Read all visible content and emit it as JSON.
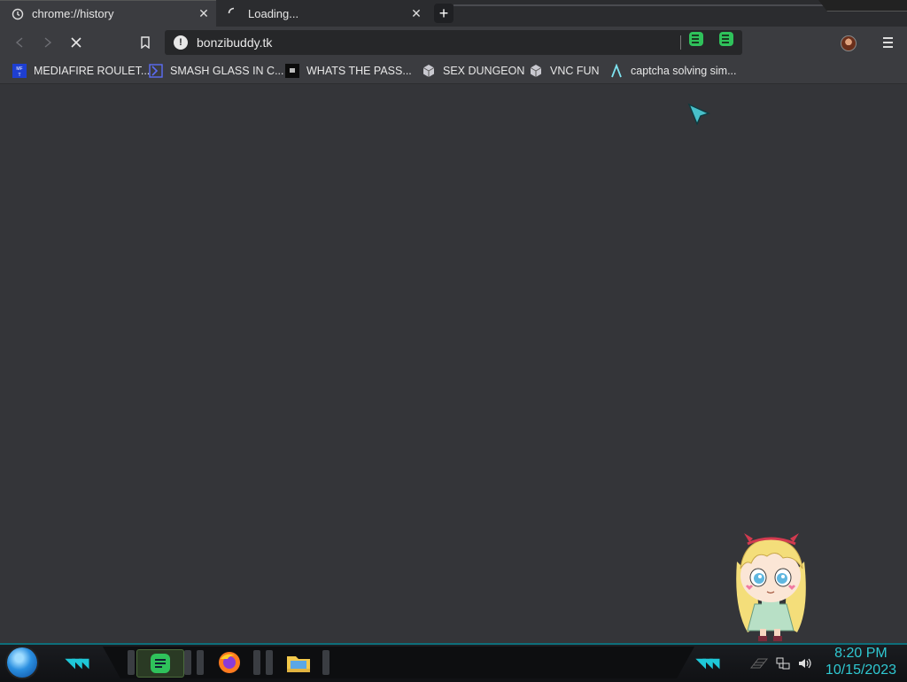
{
  "tabs": [
    {
      "title": "chrome://history",
      "icon": "history-icon",
      "active": true
    },
    {
      "title": "Loading...",
      "icon": "loading-spinner-icon",
      "active": false
    }
  ],
  "new_tab_label": "+",
  "toolbar": {
    "url": "bonzibuddy.tk",
    "security_icon": "not-secure-icon"
  },
  "bookmarks": [
    {
      "label": "MEDIAFIRE ROULET...",
      "icon": "mediafire-icon"
    },
    {
      "label": "SMASH GLASS IN C...",
      "icon": "chevron-box-icon"
    },
    {
      "label": "WHATS THE PASS...",
      "icon": "dark-square-icon"
    },
    {
      "label": "SEX DUNGEON",
      "icon": "cube-icon"
    },
    {
      "label": "VNC FUN",
      "icon": "cube-icon"
    },
    {
      "label": "captcha solving sim...",
      "icon": "lambda-icon"
    }
  ],
  "taskbar": {
    "apps": [
      "notes-app-icon",
      "firefox-icon",
      "file-explorer-icon"
    ],
    "time": "8:20 PM",
    "date": "10/15/2023"
  },
  "colors": {
    "background": "#343539",
    "accent": "#2fc8d2",
    "extension_green": "#2fc25b"
  }
}
